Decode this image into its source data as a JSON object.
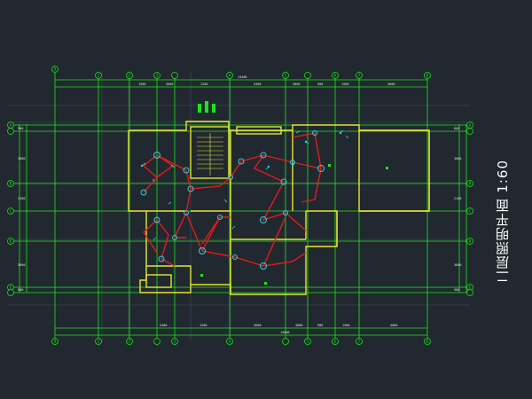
{
  "drawing": {
    "title": "二层照明平面 1:60",
    "colors": {
      "background": "#212830",
      "axis_line": "#19e619",
      "wall": "#e6e633",
      "wiring": "#e61a1a",
      "fixture": "#22d3e6",
      "dimension_text": "#e6e6e6",
      "grid_reference": "#5e6570"
    },
    "top_axis_labels": [
      "1",
      "2",
      "3",
      "4",
      "5",
      "6",
      "7",
      "8",
      "9"
    ],
    "bottom_axis_labels": [
      "1",
      "2",
      "3",
      "4",
      "5",
      "6",
      "7",
      "8",
      "9"
    ],
    "left_axis_labels": [
      "A",
      "B",
      "C",
      "D",
      "E"
    ],
    "right_axis_labels": [
      "A",
      "B",
      "C",
      "D",
      "E"
    ],
    "top_dimensions": [
      "1500",
      "3000",
      "1200",
      "5400",
      "3000",
      "900",
      "1500",
      "4000"
    ],
    "overall_top_dimension": "14400",
    "bottom_dimensions": [
      "5400",
      "1200",
      "3600",
      "3000",
      "900",
      "1500",
      "4000"
    ],
    "overall_bottom_dimension": "15000",
    "left_dimensions": [
      "900",
      "3000",
      "2100",
      "3600",
      "900"
    ],
    "right_dimensions": [
      "600",
      "3000",
      "2100",
      "3600",
      "900"
    ]
  }
}
